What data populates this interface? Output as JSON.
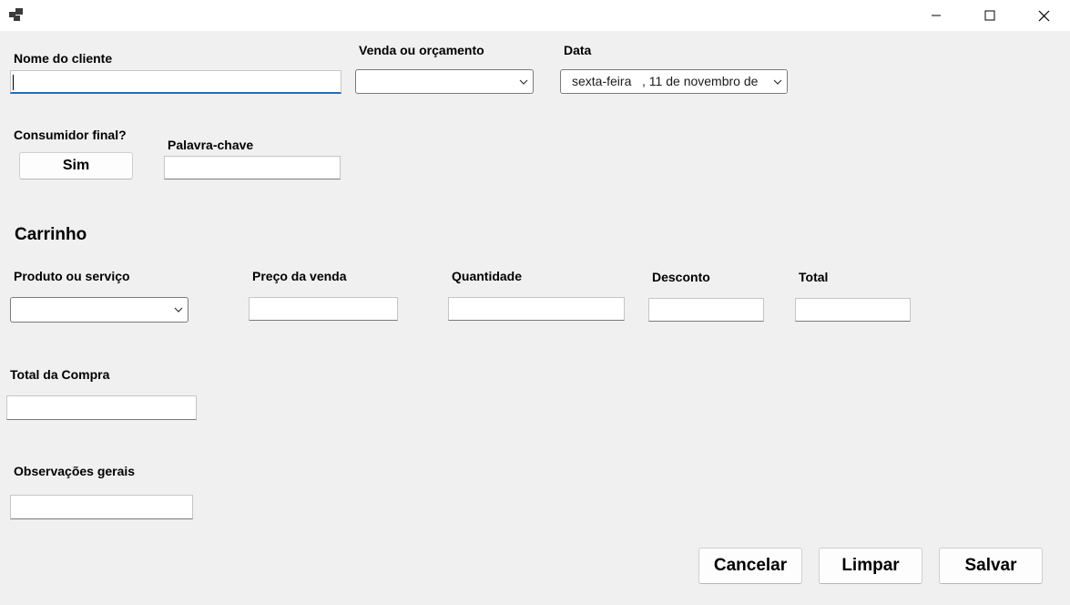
{
  "window": {
    "icon": "app-icon"
  },
  "form": {
    "customer_name_label": "Nome do cliente",
    "customer_name_value": "",
    "sale_type_label": "Venda ou orçamento",
    "sale_type_value": "",
    "date_label": "Data",
    "date_value": "sexta-feira   , 11 de novembro de",
    "final_consumer_label": "Consumidor final?",
    "final_consumer_button": "Sim",
    "keyword_label": "Palavra-chave",
    "keyword_value": ""
  },
  "cart": {
    "title": "Carrinho",
    "product_label": "Produto ou serviço",
    "price_label": "Preço da venda",
    "quantity_label": "Quantidade",
    "discount_label": "Desconto",
    "total_label": "Total"
  },
  "totals": {
    "purchase_total_label": "Total da Compra"
  },
  "notes": {
    "label": "Observações gerais"
  },
  "actions": {
    "cancel": "Cancelar",
    "clear": "Limpar",
    "save": "Salvar"
  }
}
